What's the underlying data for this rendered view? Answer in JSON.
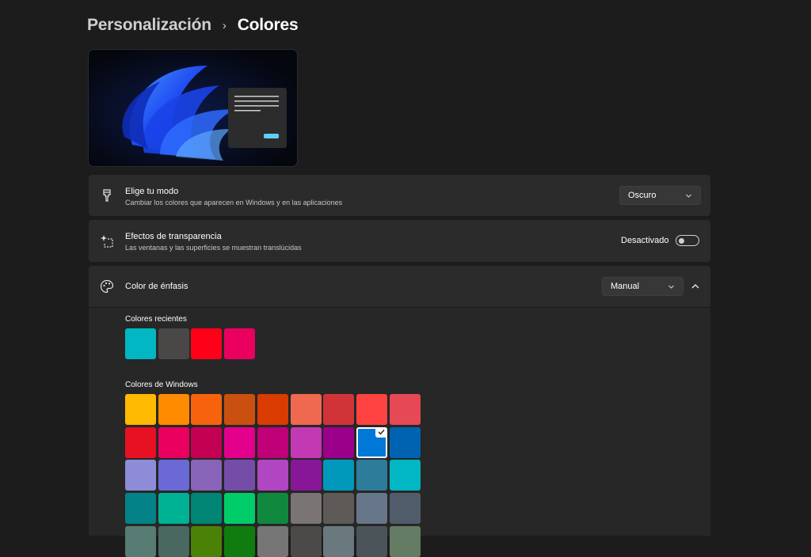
{
  "breadcrumb": {
    "parent": "Personalización",
    "separator": "›",
    "current": "Colores"
  },
  "mode_row": {
    "icon": "paintbrush-icon",
    "title": "Elige tu modo",
    "description": "Cambiar los colores que aparecen en Windows y en las aplicaciones",
    "dropdown_value": "Oscuro"
  },
  "transparency_row": {
    "icon": "sparkle-icon",
    "title": "Efectos de transparencia",
    "description": "Las ventanas y las superficies se muestran translúcidas",
    "toggle_label": "Desactivado",
    "toggle_on": false
  },
  "accent_row": {
    "icon": "palette-icon",
    "title": "Color de énfasis",
    "dropdown_value": "Manual",
    "expanded": true
  },
  "recent_colors": {
    "label": "Colores recientes",
    "swatches": [
      "#00b7c3",
      "#4a4846",
      "#ff0019",
      "#ea005e"
    ]
  },
  "windows_colors": {
    "label": "Colores de Windows",
    "selected": "#0078d7",
    "rows": [
      [
        "#ffb900",
        "#ff8c00",
        "#f7630c",
        "#ca5010",
        "#da3b01",
        "#ef6950",
        "#d13438",
        "#ff4343",
        "#e74856"
      ],
      [
        "#e81123",
        "#ea005e",
        "#c30052",
        "#e3008c",
        "#bf0077",
        "#c239b3",
        "#9a0089",
        "#0078d7",
        "#0063b1"
      ],
      [
        "#8e8cd8",
        "#6b69d6",
        "#8764b8",
        "#744da9",
        "#b146c2",
        "#881798",
        "#0099bc",
        "#2d7d9a",
        "#00b7c3"
      ],
      [
        "#038387",
        "#00b294",
        "#018574",
        "#00cc6a",
        "#10893e",
        "#7a7574",
        "#5d5a58",
        "#68768a",
        "#515c6b"
      ],
      [
        "#567c73",
        "#486860",
        "#498205",
        "#107c10",
        "#767676",
        "#4c4a48",
        "#69797e",
        "#4a5459",
        "#647c64"
      ]
    ]
  },
  "colors": {
    "background": "#1c1c1c",
    "card": "#2b2b2b",
    "accent_selected": "#0078d7"
  }
}
